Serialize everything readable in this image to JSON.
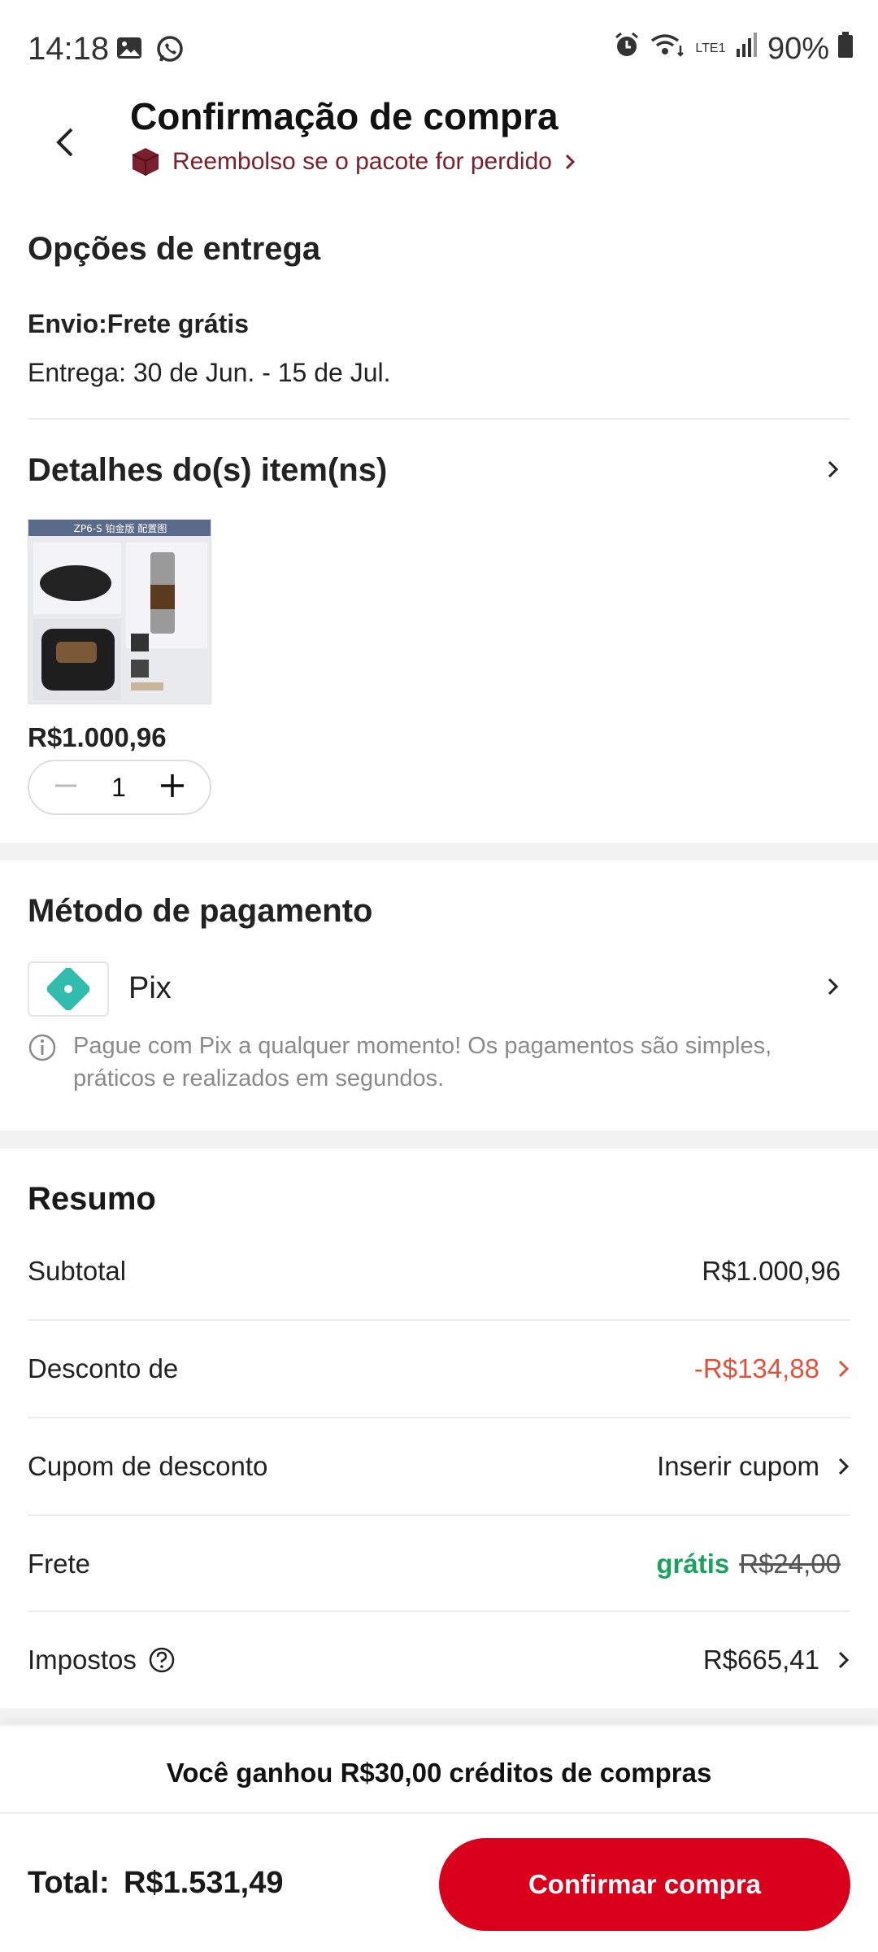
{
  "status_bar": {
    "time": "14:18",
    "battery": "90%",
    "network": "LTE1"
  },
  "header": {
    "title": "Confirmação de compra",
    "refund_text": "Reembolso se o pacote for perdido"
  },
  "delivery": {
    "title": "Opções de entrega",
    "shipping": "Envio:Frete grátis",
    "eta": "Entrega: 30 de Jun. - 15 de Jul."
  },
  "items": {
    "title": "Detalhes do(s) item(ns)",
    "product": {
      "image_caption": "ZP6-S 铂金版 配置图",
      "price": "R$1.000,96",
      "quantity": "1"
    }
  },
  "payment": {
    "title": "Método de pagamento",
    "method": "Pix",
    "info": "Pague com Pix a qualquer momento! Os pagamentos são simples, práticos e realizados em segundos."
  },
  "summary": {
    "title": "Resumo",
    "subtotal_label": "Subtotal",
    "subtotal_value": "R$1.000,96",
    "discount_label": "Desconto de",
    "discount_value": "-R$134,88",
    "coupon_label": "Cupom de desconto",
    "coupon_value": "Inserir cupom",
    "shipping_label": "Frete",
    "shipping_free": "grátis",
    "shipping_old": "R$24,00",
    "tax_label": "Impostos",
    "tax_value": "R$665,41"
  },
  "credits_banner": "Você ganhou R$30,00 créditos de compras",
  "footer": {
    "total_label": "Total:",
    "total_value": "R$1.531,49",
    "confirm_label": "Confirmar compra"
  },
  "colors": {
    "accent": "#d9001b",
    "discount": "#e0533a",
    "free": "#1aa260",
    "pix": "#32bcad"
  }
}
